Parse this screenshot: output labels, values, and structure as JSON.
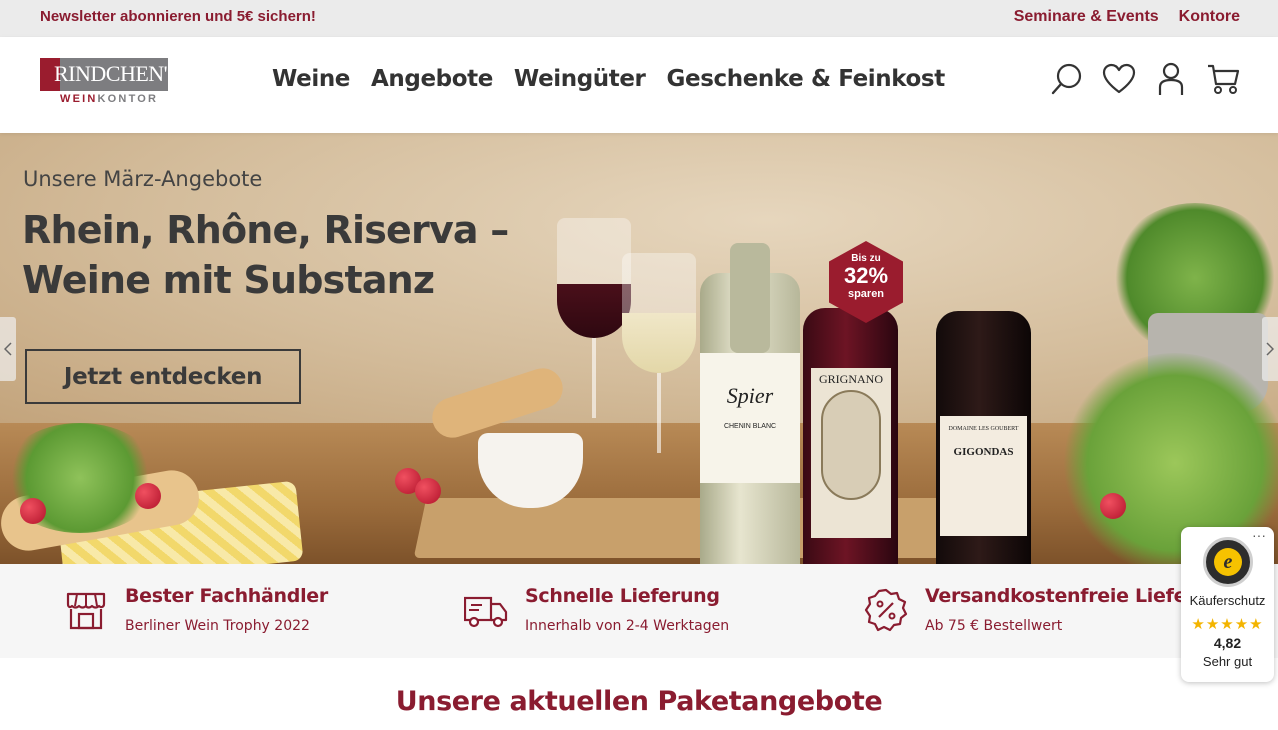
{
  "topbar": {
    "promo": "Newsletter abonnieren und 5€ sichern!",
    "links": [
      "Seminare & Events",
      "Kontore"
    ]
  },
  "header": {
    "logo_name": "RINDCHEN'S",
    "logo_sub_1": "WEIN",
    "logo_sub_2": "KONTOR",
    "nav": [
      "Weine",
      "Angebote",
      "Weingüter",
      "Geschenke & Feinkost"
    ],
    "icons": [
      "search-icon",
      "heart-icon",
      "user-icon",
      "cart-icon"
    ]
  },
  "hero": {
    "kicker": "Unsere März-Angebote",
    "headline_line1": "Rhein, Rhône, Riserva –",
    "headline_line2": "Weine mit Substanz",
    "cta": "Jetzt entdecken",
    "badge_prefix": "Bis zu",
    "badge_percent": "32%",
    "badge_suffix": "sparen",
    "bottle1_label": "Spier",
    "bottle1_sub": "CHENIN BLANC",
    "bottle2_label": "GRIGNANO",
    "bottle3_label_top": "DOMAINE LES GOUBERT",
    "bottle3_label": "GIGONDAS"
  },
  "usp": [
    {
      "icon": "store-icon",
      "title": "Bester Fachhändler",
      "desc": "Berliner Wein Trophy 2022"
    },
    {
      "icon": "truck-icon",
      "title": "Schnelle Lieferung",
      "desc": "Innerhalb von 2-4 Werktagen"
    },
    {
      "icon": "percent-badge-icon",
      "title": "Versandkostenfreie Lieferung",
      "desc": "Ab 75 € Bestellwert"
    }
  ],
  "section_title": "Unsere aktuellen Paketangebote",
  "trusted_shops": {
    "label": "Käuferschutz",
    "stars": "★★★★★",
    "score": "4,82",
    "rating": "Sehr gut",
    "menu": "···"
  },
  "colors": {
    "brand": "#8a1c30",
    "logo_grey": "#7d7d80",
    "stars": "#f3b400"
  }
}
